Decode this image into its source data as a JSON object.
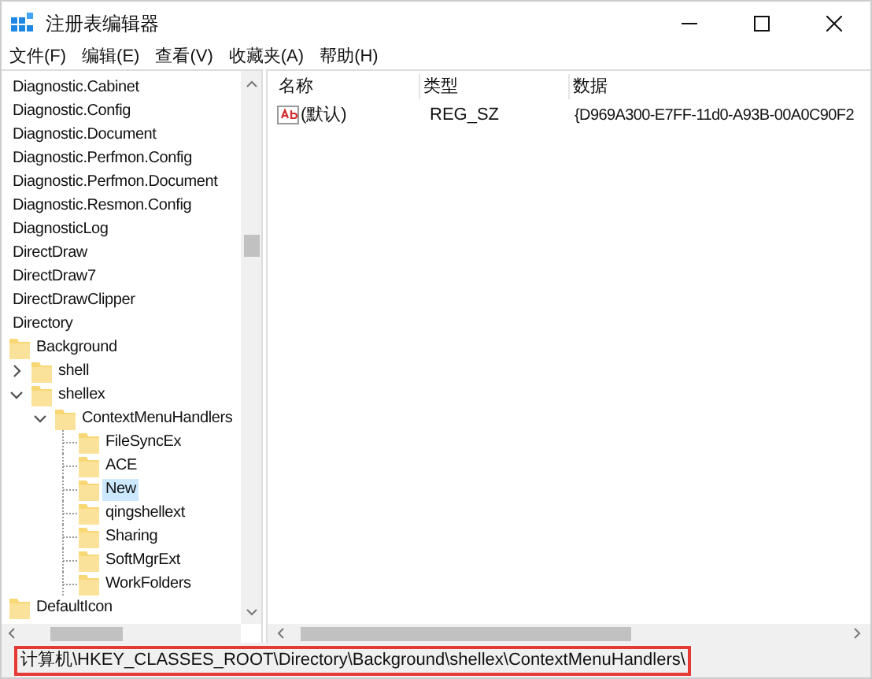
{
  "window": {
    "title": "注册表编辑器"
  },
  "menu": [
    "文件(F)",
    "编辑(E)",
    "查看(V)",
    "收藏夹(A)",
    "帮助(H)"
  ],
  "tree": [
    {
      "label": "Diagnostic.Cabinet",
      "selected": false
    },
    {
      "label": "Diagnostic.Config",
      "selected": false
    },
    {
      "label": "Diagnostic.Document",
      "selected": false
    },
    {
      "label": "Diagnostic.Perfmon.Config",
      "selected": false
    },
    {
      "label": "Diagnostic.Perfmon.Document",
      "selected": false
    },
    {
      "label": "Diagnostic.Resmon.Config",
      "selected": false
    },
    {
      "label": "DiagnosticLog",
      "selected": false
    },
    {
      "label": "DirectDraw",
      "selected": false
    },
    {
      "label": "DirectDraw7",
      "selected": false
    },
    {
      "label": "DirectDrawClipper",
      "selected": false
    },
    {
      "label": "Directory",
      "selected": false,
      "children": [
        {
          "label": "Background",
          "selected": false,
          "children": [
            {
              "label": "shell",
              "selected": false,
              "expanded": false
            },
            {
              "label": "shellex",
              "selected": false,
              "expanded": true,
              "children": [
                {
                  "label": "ContextMenuHandlers",
                  "selected": false,
                  "expanded": true,
                  "children": [
                    {
                      "label": "FileSyncEx",
                      "selected": false
                    },
                    {
                      "label": "ACE",
                      "selected": false
                    },
                    {
                      "label": "New",
                      "selected": true
                    },
                    {
                      "label": "qingshellext",
                      "selected": false
                    },
                    {
                      "label": "Sharing",
                      "selected": false
                    },
                    {
                      "label": "SoftMgrExt",
                      "selected": false
                    },
                    {
                      "label": "WorkFolders",
                      "selected": false
                    }
                  ]
                }
              ]
            }
          ]
        },
        {
          "label": "DefaultIcon",
          "selected": false
        }
      ]
    }
  ],
  "values": {
    "columns": [
      "名称",
      "类型",
      "数据"
    ],
    "rows": [
      {
        "name": "(默认)",
        "type": "REG_SZ",
        "data": "{D969A300-E7FF-11d0-A93B-00A0C90F2"
      }
    ]
  },
  "status_bar": {
    "path": "计算机\\HKEY_CLASSES_ROOT\\Directory\\Background\\shellex\\ContextMenuHandlers\\",
    "highlighted": true
  }
}
